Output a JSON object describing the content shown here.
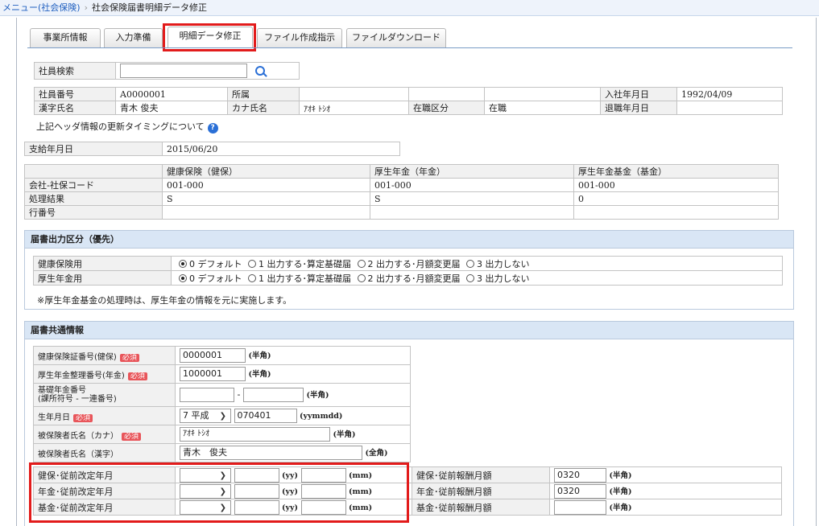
{
  "breadcrumb": {
    "root": "メニュー(社会保険)",
    "current": "社会保険届書明細データ修正"
  },
  "tabs": [
    "事業所情報",
    "入力準備",
    "明細データ修正",
    "ファイル作成指示",
    "ファイルダウンロード"
  ],
  "search": {
    "label": "社員検索",
    "value": ""
  },
  "employee": {
    "no_label": "社員番号",
    "no": "A0000001",
    "dept_label": "所属",
    "dept": "",
    "join_label": "入社年月日",
    "join": "1992/04/09",
    "name_label": "漢字氏名",
    "name": "青木 俊夫",
    "kana_label": "カナ氏名",
    "kana": "ｱｵｷ ﾄｼｵ",
    "status_label": "在職区分",
    "status": "在職",
    "retire_label": "退職年月日",
    "retire": ""
  },
  "header_note": "上記ヘッダ情報の更新タイミングについて",
  "help_mark": "?",
  "pay_date": {
    "label": "支給年月日",
    "value": "2015/06/20"
  },
  "codes": {
    "headers": [
      "健康保険（健保）",
      "厚生年金（年金）",
      "厚生年金基金（基金）"
    ],
    "rows": [
      {
        "label": "会社-社保コード",
        "values": [
          "001-000",
          "001-000",
          "001-000"
        ]
      },
      {
        "label": "処理結果",
        "values": [
          "S",
          "S",
          "0"
        ]
      },
      {
        "label": "行番号",
        "values": [
          "",
          "",
          ""
        ]
      }
    ]
  },
  "output": {
    "title": "届書出力区分（優先）",
    "options": [
      "0 デフォルト",
      "1 出力する･算定基礎届",
      "2 出力する･月額変更届",
      "3 出力しない"
    ],
    "rows": [
      {
        "label": "健康保険用",
        "selected": 0
      },
      {
        "label": "厚生年金用",
        "selected": 0
      }
    ],
    "note": "※厚生年金基金の処理時は、厚生年金の情報を元に実施します。"
  },
  "common": {
    "title": "届書共通情報",
    "required": "必須",
    "han": "(半角)",
    "zen": "(全角)",
    "hyphen": "-",
    "health_no": {
      "label": "健康保険証番号(健保)",
      "value": "0000001"
    },
    "pension_no": {
      "label": "厚生年金整理番号(年金)",
      "value": "1000001"
    },
    "basic_no": {
      "label": "基礎年金番号",
      "sub": "(課所符号 - 一連番号)",
      "a": "",
      "b": ""
    },
    "birth": {
      "label": "生年月日",
      "era": "7 平成",
      "value": "070401",
      "fmt": "(yymmdd)"
    },
    "kana": {
      "label": "被保険者氏名（カナ）",
      "value": "ｱｵｷ ﾄｼｵ"
    },
    "kanji": {
      "label": "被保険者氏名（漢字）",
      "value": "青木　俊夫"
    },
    "revisions": [
      {
        "label": "健保･従前改定年月",
        "era": "",
        "yy": "",
        "mm": "",
        "pay_label": "健保･従前報酬月額",
        "pay": "0320"
      },
      {
        "label": "年金･従前改定年月",
        "era": "",
        "yy": "",
        "mm": "",
        "pay_label": "年金･従前報酬月額",
        "pay": "0320"
      },
      {
        "label": "基金･従前改定年月",
        "era": "",
        "yy": "",
        "mm": "",
        "pay_label": "基金･従前報酬月額",
        "pay": ""
      }
    ],
    "yy_unit": "(yy)",
    "mm_unit": "(mm)"
  }
}
